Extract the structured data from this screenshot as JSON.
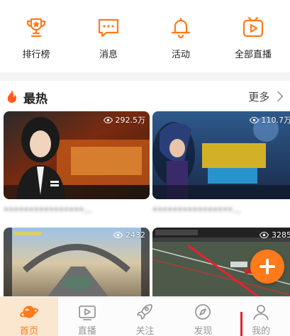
{
  "colors": {
    "accent": "#ff7a1a",
    "active_tab_bg": "#fbe7d0",
    "text": "#222222",
    "muted": "#999999"
  },
  "quick_nav": [
    {
      "label": "排行榜",
      "icon": "trophy-icon"
    },
    {
      "label": "消息",
      "icon": "message-icon"
    },
    {
      "label": "活动",
      "icon": "bell-icon"
    },
    {
      "label": "全部直播",
      "icon": "video-play-icon"
    }
  ],
  "section": {
    "title": "最热",
    "icon": "fire-icon",
    "more_label": "更多"
  },
  "cards": [
    {
      "views": "292.5万",
      "title": "••••••••••••••••..."
    },
    {
      "views": "110.7万",
      "title": "••••••••••••••••..."
    },
    {
      "views": "2432",
      "title": ""
    },
    {
      "views": "3285",
      "title": ""
    }
  ],
  "fab": {
    "icon": "plus-icon"
  },
  "tabs": [
    {
      "label": "首页",
      "icon": "planet-icon",
      "active": true
    },
    {
      "label": "直播",
      "icon": "tv-icon",
      "active": false
    },
    {
      "label": "关注",
      "icon": "rocket-icon",
      "active": false
    },
    {
      "label": "发现",
      "icon": "compass-icon",
      "active": false
    },
    {
      "label": "我的",
      "icon": "user-icon",
      "active": false
    }
  ]
}
